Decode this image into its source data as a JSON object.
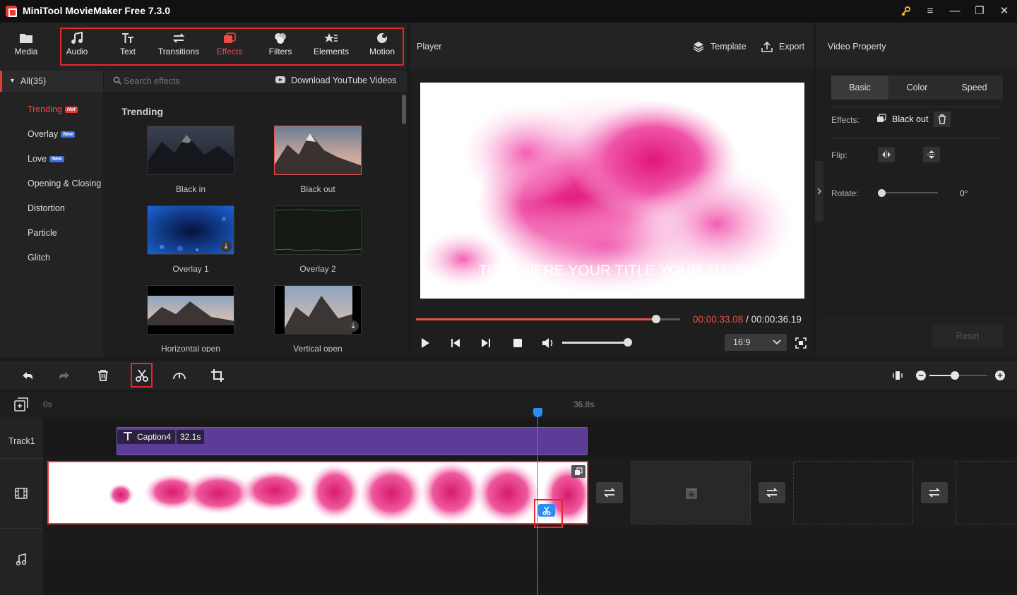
{
  "window": {
    "title": "MiniTool MovieMaker Free 7.3.0",
    "controls": [
      "key-icon",
      "menu-icon",
      "minimize-icon",
      "maximize-icon",
      "close-icon"
    ]
  },
  "toolbar": {
    "items": [
      {
        "label": "Media",
        "icon": "folder-icon"
      },
      {
        "label": "Audio",
        "icon": "music-note-icon"
      },
      {
        "label": "Text",
        "icon": "text-icon"
      },
      {
        "label": "Transitions",
        "icon": "transitions-icon"
      },
      {
        "label": "Effects",
        "icon": "effects-icon",
        "active": true
      },
      {
        "label": "Filters",
        "icon": "filters-icon"
      },
      {
        "label": "Elements",
        "icon": "elements-icon"
      },
      {
        "label": "Motion",
        "icon": "motion-icon"
      }
    ]
  },
  "library": {
    "category_all": "All(35)",
    "categories": [
      {
        "label": "Trending",
        "badge": "Hot",
        "active": true
      },
      {
        "label": "Overlay",
        "badge": "New"
      },
      {
        "label": "Love",
        "badge": "New"
      },
      {
        "label": "Opening & Closing",
        "badge": ""
      },
      {
        "label": "Distortion",
        "badge": ""
      },
      {
        "label": "Particle",
        "badge": ""
      },
      {
        "label": "Glitch",
        "badge": ""
      }
    ],
    "search_placeholder": "Search effects",
    "download_link": "Download YouTube Videos",
    "section_title": "Trending",
    "effects": [
      {
        "label": "Black in"
      },
      {
        "label": "Black out",
        "selected": true
      },
      {
        "label": "Overlay 1",
        "downloadable": true
      },
      {
        "label": "Overlay 2"
      },
      {
        "label": "Horizontal open"
      },
      {
        "label": "Vertical open",
        "downloadable": true
      }
    ]
  },
  "player": {
    "title": "Player",
    "template_label": "Template",
    "export_label": "Export",
    "overlay_text": "TITLE HERE YOUR TITLE YOUR TITLE",
    "current_time": "00:00:33.08",
    "total_time": "/ 00:00:36.19",
    "progress": 0.91,
    "volume": 1.0,
    "aspect_ratio": "16:9",
    "accent_color": "#ef4d48"
  },
  "properties": {
    "title": "Video Property",
    "tabs": [
      "Basic",
      "Color",
      "Speed"
    ],
    "effects_label": "Effects:",
    "effect_value": "Black out",
    "flip_label": "Flip:",
    "rotate_label": "Rotate:",
    "rotate_value": "0°",
    "reset_label": "Reset"
  },
  "timeline": {
    "tools": [
      "undo-icon",
      "redo-icon",
      "delete-icon",
      "split-icon",
      "speed-icon",
      "crop-icon"
    ],
    "ruler_start": "0s",
    "ruler_end": "36.8s",
    "track1_label": "Track1",
    "caption_clip": {
      "name": "Caption4",
      "duration": "32.1s"
    },
    "playhead_color": "#2d8cf0"
  }
}
